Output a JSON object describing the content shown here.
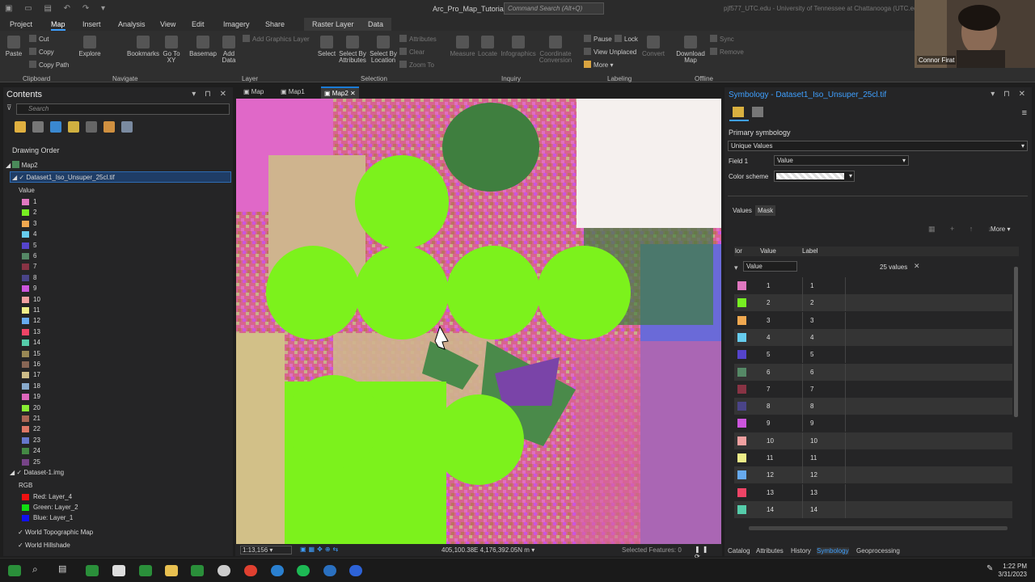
{
  "app": {
    "title": "Arc_Pro_Map_Tutorial",
    "search_placeholder": "Command Search (Alt+Q)",
    "account": "pjf577_UTC.edu - University of Tennessee at Chattanooga (UTC.edu)"
  },
  "ribbon_tabs": [
    "Project",
    "Map",
    "Insert",
    "Analysis",
    "View",
    "Edit",
    "Imagery",
    "Share",
    "Raster Layer",
    "Data"
  ],
  "ribbon_context_label": "Raster Layer",
  "ribbon": {
    "clipboard": {
      "paste": "Paste",
      "cut": "Cut",
      "copy": "Copy",
      "copy_path": "Copy Path",
      "group": "Clipboard"
    },
    "navigate": {
      "explore": "Explore",
      "bookmarks": "Bookmarks",
      "go_to_xy": "Go To XY",
      "group": "Navigate"
    },
    "layer": {
      "basemap": "Basemap",
      "add_data": "Add Data",
      "add_graphics": "Add Graphics Layer",
      "group": "Layer"
    },
    "selection": {
      "select": "Select",
      "by_attributes": "Select By Attributes",
      "by_location": "Select By Location",
      "attributes": "Attributes",
      "clear": "Clear",
      "zoom_to": "Zoom To",
      "group": "Selection"
    },
    "inquiry": {
      "measure": "Measure",
      "locate": "Locate",
      "infographics": "Infographics",
      "coordinate": "Coordinate Conversion",
      "group": "Inquiry"
    },
    "labeling": {
      "pause": "Pause",
      "lock": "Lock",
      "view_unplaced": "View Unplaced",
      "more": "More",
      "convert": "Convert",
      "group": "Labeling"
    },
    "offline": {
      "download": "Download Map",
      "sync": "Sync",
      "remove": "Remove",
      "group": "Offline"
    }
  },
  "contents": {
    "title": "Contents",
    "search_placeholder": "Search",
    "drawing_order": "Drawing Order",
    "map_name": "Map2",
    "layer1": "Dataset1_Iso_Unsuper_25cl.tif",
    "value_label": "Value",
    "classes": [
      {
        "v": "1",
        "color": "#e078c0"
      },
      {
        "v": "2",
        "color": "#77ee22"
      },
      {
        "v": "3",
        "color": "#f0a850"
      },
      {
        "v": "4",
        "color": "#66ccee"
      },
      {
        "v": "5",
        "color": "#5544cc"
      },
      {
        "v": "6",
        "color": "#558866"
      },
      {
        "v": "7",
        "color": "#883344"
      },
      {
        "v": "8",
        "color": "#4a4488"
      },
      {
        "v": "9",
        "color": "#cc55dd"
      },
      {
        "v": "10",
        "color": "#f0a0a0"
      },
      {
        "v": "11",
        "color": "#eeee88"
      },
      {
        "v": "12",
        "color": "#66aaee"
      },
      {
        "v": "13",
        "color": "#ee4466"
      },
      {
        "v": "14",
        "color": "#55ccaa"
      },
      {
        "v": "15",
        "color": "#998855"
      },
      {
        "v": "16",
        "color": "#886655"
      },
      {
        "v": "17",
        "color": "#ccbb88"
      },
      {
        "v": "18",
        "color": "#88aacc"
      },
      {
        "v": "19",
        "color": "#dd66bb"
      },
      {
        "v": "20",
        "color": "#88ee33"
      },
      {
        "v": "21",
        "color": "#aa6655"
      },
      {
        "v": "22",
        "color": "#dd7766"
      },
      {
        "v": "23",
        "color": "#6677cc"
      },
      {
        "v": "24",
        "color": "#448844"
      },
      {
        "v": "25",
        "color": "#774488"
      }
    ],
    "layer2": "Dataset-1.img",
    "rgb_label": "RGB",
    "red": "Red:   Layer_4",
    "green": "Green: Layer_2",
    "blue": "Blue:  Layer_1",
    "basemap1": "World Topographic Map",
    "basemap2": "World Hillshade"
  },
  "map_tabs": [
    "Map",
    "Map1",
    "Map2"
  ],
  "map_status": {
    "scale": "1:13,156",
    "coords": "405,100.38E 4,176,392.05N m",
    "selected": "Selected Features: 0"
  },
  "symbology": {
    "title": "Symbology - Dataset1_Iso_Unsuper_25cl.tif",
    "primary": "Primary symbology",
    "method": "Unique Values",
    "field1_label": "Field 1",
    "field1_value": "Value",
    "color_scheme_label": "Color scheme",
    "subtabs": [
      "Values",
      "Mask"
    ],
    "more": "More",
    "col_color": "lor",
    "col_value": "Value",
    "col_label": "Label",
    "group_value": "Value",
    "count": "25 values",
    "rows": [
      {
        "v": "1",
        "color": "#e078c0"
      },
      {
        "v": "2",
        "color": "#77ee22"
      },
      {
        "v": "3",
        "color": "#f0a850"
      },
      {
        "v": "4",
        "color": "#66ccee"
      },
      {
        "v": "5",
        "color": "#5544cc"
      },
      {
        "v": "6",
        "color": "#558866"
      },
      {
        "v": "7",
        "color": "#883344"
      },
      {
        "v": "8",
        "color": "#4a4488"
      },
      {
        "v": "9",
        "color": "#cc55dd"
      },
      {
        "v": "10",
        "color": "#f0a0a0"
      },
      {
        "v": "11",
        "color": "#eeee88"
      },
      {
        "v": "12",
        "color": "#66aaee"
      },
      {
        "v": "13",
        "color": "#ee4466"
      },
      {
        "v": "14",
        "color": "#55ccaa"
      }
    ]
  },
  "bottom_tabs": [
    "Catalog",
    "Attributes",
    "History",
    "Symbology",
    "Geoprocessing"
  ],
  "taskbar": {
    "time": "1:22 PM",
    "date": "3/31/2023"
  },
  "webcam_name": "Connor Firat"
}
